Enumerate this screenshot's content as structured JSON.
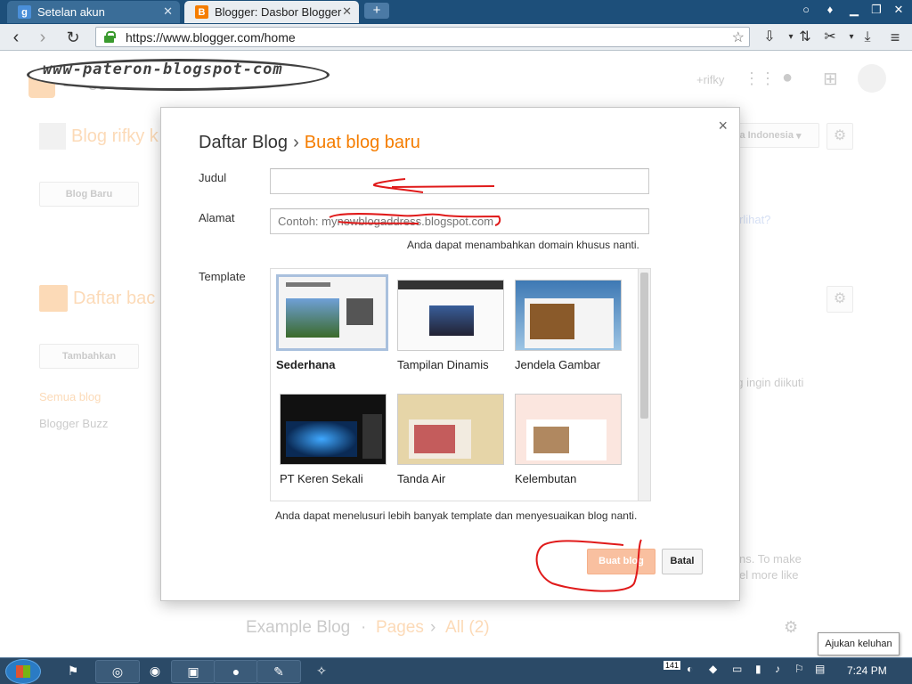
{
  "browser": {
    "tabs": [
      {
        "label": "Setelan akun",
        "favicon": "g",
        "active": false
      },
      {
        "label": "Blogger: Dasbor Blogger",
        "favicon": "B",
        "active": true
      }
    ],
    "new_tab_label": "+",
    "url": "https://www.blogger.com/home"
  },
  "watermark": "www-pateron-blogspot-com",
  "background": {
    "logo_text": "Blogger",
    "user_label": "+rifky",
    "blog_title": "Blog rifky k",
    "new_blog_button": "Blog Baru",
    "language_label": "a Indonesia",
    "question_fragment": "rlihat?",
    "reading_list_title": "Daftar bac",
    "add_button": "Tambahkan",
    "all_blogs_link": "Semua blog",
    "blogger_buzz": "Blogger Buzz",
    "follow_hint": "ng ingin diikuti",
    "right_text_line1": "ns. To make",
    "right_text_line2": "el more like",
    "example_blog": "Example Blog",
    "dot": "·",
    "pages": "Pages",
    "chevron": "›",
    "all_count": "All (2)"
  },
  "dialog": {
    "close_glyph": "×",
    "title": "Daftar Blog",
    "title_sep": "›",
    "subtitle": "Buat blog baru",
    "title_label": "Judul",
    "title_value": "",
    "address_label": "Alamat",
    "address_placeholder": "Contoh: mynewblogaddress.blogspot.com",
    "address_hint": "Anda dapat menambahkan domain khusus nanti.",
    "template_label": "Template",
    "templates": [
      {
        "name": "Sederhana",
        "selected": true
      },
      {
        "name": "Tampilan Dinamis",
        "selected": false
      },
      {
        "name": "Jendela Gambar",
        "selected": false
      },
      {
        "name": "PT Keren Sekali",
        "selected": false
      },
      {
        "name": "Tanda Air",
        "selected": false
      },
      {
        "name": "Kelembutan",
        "selected": false
      }
    ],
    "template_hint": "Anda dapat menelusuri lebih banyak template dan menyesuaikan blog nanti.",
    "create_button": "Buat blog",
    "cancel_button": "Batal"
  },
  "taskbar": {
    "tooltip": "Ajukan keluhan",
    "clock": "7:24 PM",
    "tray_badge": "141"
  },
  "colors": {
    "accent": "#f57d00",
    "titlebar": "#1d4f7a",
    "annotation": "#e01a1a"
  }
}
